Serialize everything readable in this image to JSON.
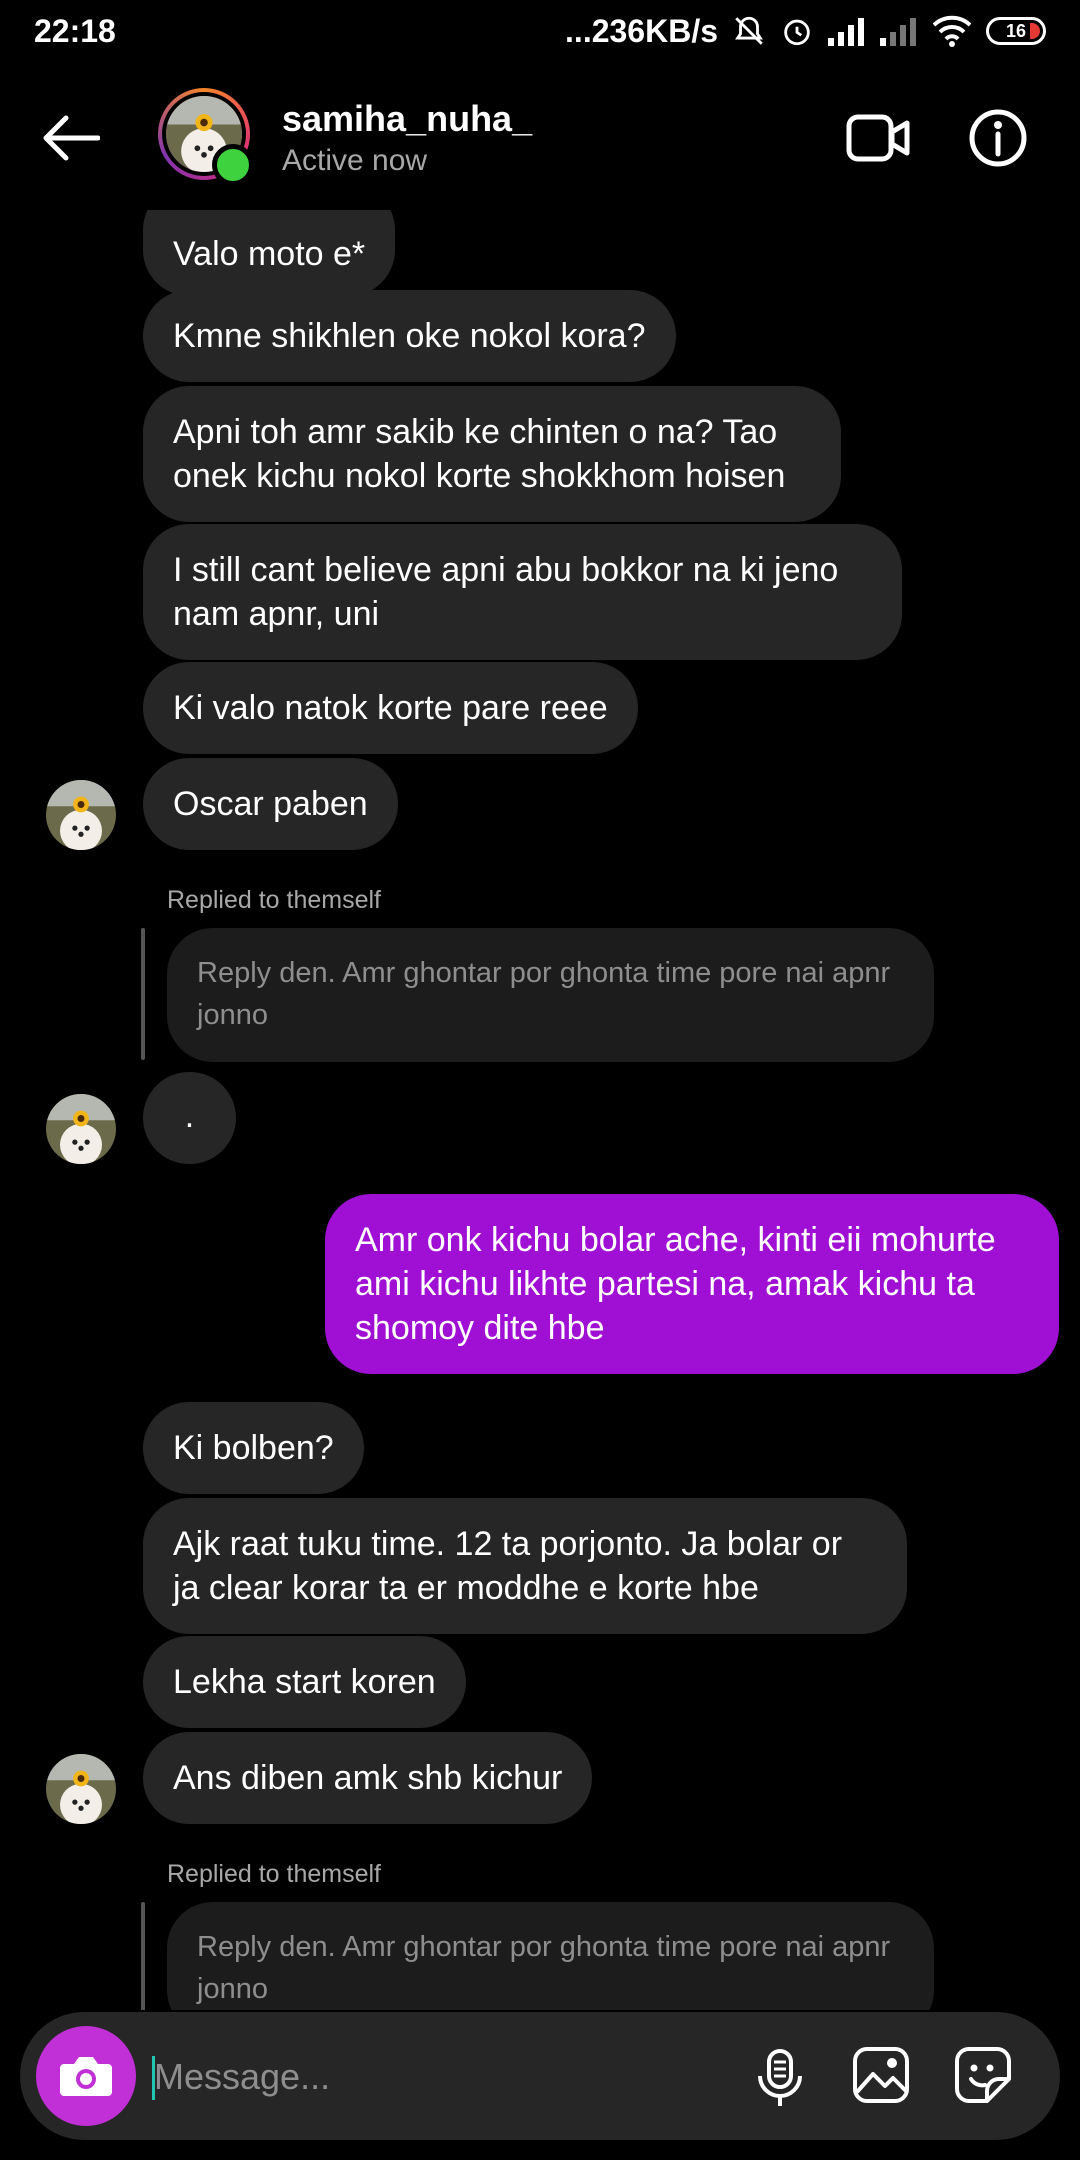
{
  "status_bar": {
    "time": "22:18",
    "network_speed": "...236KB/s",
    "battery": "16",
    "icons": [
      "mute-icon",
      "alarm-icon",
      "signal-icon",
      "signal-weak-icon",
      "wifi-icon",
      "battery-icon"
    ]
  },
  "header": {
    "contact_name": "samiha_nuha_",
    "status": "Active now",
    "online_color": "#3fd23f"
  },
  "messages": [
    {
      "text": "Valo moto e*",
      "from": "them"
    },
    {
      "text": "Kmne shikhlen oke nokol kora?",
      "from": "them"
    },
    {
      "text": "Apni toh amr sakib ke chinten o na? Tao onek kichu nokol korte shokkhom hoisen",
      "from": "them"
    },
    {
      "text": "I still cant believe apni abu bokkor na ki jeno nam apnr, uni",
      "from": "them"
    },
    {
      "text": "Ki valo natok korte pare reee",
      "from": "them"
    },
    {
      "text": "Oscar paben",
      "from": "them",
      "avatar": true
    },
    {
      "replied_label": "Replied to themself",
      "reply_text": "Reply den. Amr ghontar por ghonta time pore nai apnr jonno"
    },
    {
      "text": ".",
      "from": "them",
      "avatar": true
    },
    {
      "text": "Amr onk kichu bolar ache, kinti eii mohurte ami kichu likhte partesi na, amak kichu ta shomoy dite hbe",
      "from": "me"
    },
    {
      "text": "Ki bolben?",
      "from": "them"
    },
    {
      "text": "Ajk raat tuku time. 12 ta porjonto. Ja bolar or ja clear korar ta er moddhe e korte hbe",
      "from": "them"
    },
    {
      "text": "Lekha start koren",
      "from": "them"
    },
    {
      "text": "Ans diben amk shb kichur",
      "from": "them",
      "avatar": true
    },
    {
      "replied_label": "Replied to themself",
      "reply_text": "Reply den. Amr ghontar por ghonta time pore nai apnr jonno"
    }
  ],
  "composer": {
    "placeholder": "Message...",
    "accent": "#c12fd6"
  },
  "colors": {
    "my_bubble": "#a010d4",
    "their_bubble": "#262626"
  }
}
